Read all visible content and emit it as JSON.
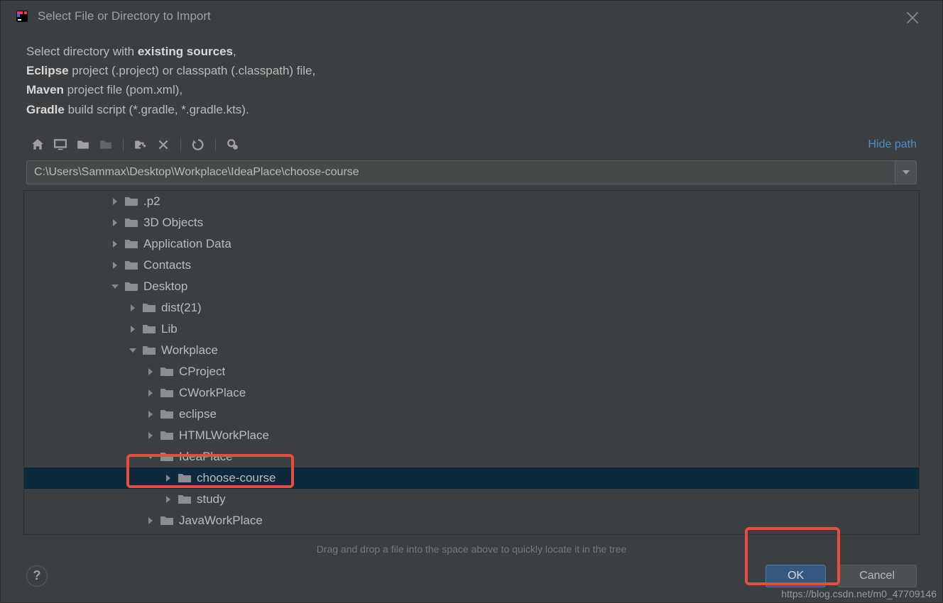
{
  "dialog": {
    "title": "Select File or Directory to Import"
  },
  "description": {
    "line1_text": "Select directory with ",
    "line1_bold": "existing sources",
    "line1_suffix": ",",
    "line2_bold": "Eclipse",
    "line2_text": " project (.project) or classpath (.classpath) file,",
    "line3_bold": "Maven",
    "line3_text": " project file (pom.xml),",
    "line4_bold": "Gradle",
    "line4_text": " build script (*.gradle, *.gradle.kts)."
  },
  "toolbar": {
    "hide_path_label": "Hide path"
  },
  "path": {
    "value": "C:\\Users\\Sammax\\Desktop\\Workplace\\IdeaPlace\\choose-course"
  },
  "tree": {
    "items": [
      {
        "label": ".p2",
        "indent": 0,
        "expanded": false,
        "selected": false
      },
      {
        "label": "3D Objects",
        "indent": 0,
        "expanded": false,
        "selected": false
      },
      {
        "label": "Application Data",
        "indent": 0,
        "expanded": false,
        "selected": false,
        "special": true
      },
      {
        "label": "Contacts",
        "indent": 0,
        "expanded": false,
        "selected": false
      },
      {
        "label": "Desktop",
        "indent": 0,
        "expanded": true,
        "selected": false
      },
      {
        "label": "dist(21)",
        "indent": 1,
        "expanded": false,
        "selected": false
      },
      {
        "label": "Lib",
        "indent": 1,
        "expanded": false,
        "selected": false
      },
      {
        "label": "Workplace",
        "indent": 1,
        "expanded": true,
        "selected": false
      },
      {
        "label": "CProject",
        "indent": 2,
        "expanded": false,
        "selected": false
      },
      {
        "label": "CWorkPlace",
        "indent": 2,
        "expanded": false,
        "selected": false
      },
      {
        "label": "eclipse",
        "indent": 2,
        "expanded": false,
        "selected": false
      },
      {
        "label": "HTMLWorkPlace",
        "indent": 2,
        "expanded": false,
        "selected": false
      },
      {
        "label": "IdeaPlace",
        "indent": 2,
        "expanded": true,
        "selected": false
      },
      {
        "label": "choose-course",
        "indent": 3,
        "expanded": false,
        "selected": true
      },
      {
        "label": "study",
        "indent": 3,
        "expanded": false,
        "selected": false
      },
      {
        "label": "JavaWorkPlace",
        "indent": 2,
        "expanded": false,
        "selected": false
      }
    ]
  },
  "hint": "Drag and drop a file into the space above to quickly locate it in the tree",
  "buttons": {
    "ok": "OK",
    "cancel": "Cancel",
    "help": "?"
  },
  "watermark": "https://blog.csdn.net/m0_47709146"
}
